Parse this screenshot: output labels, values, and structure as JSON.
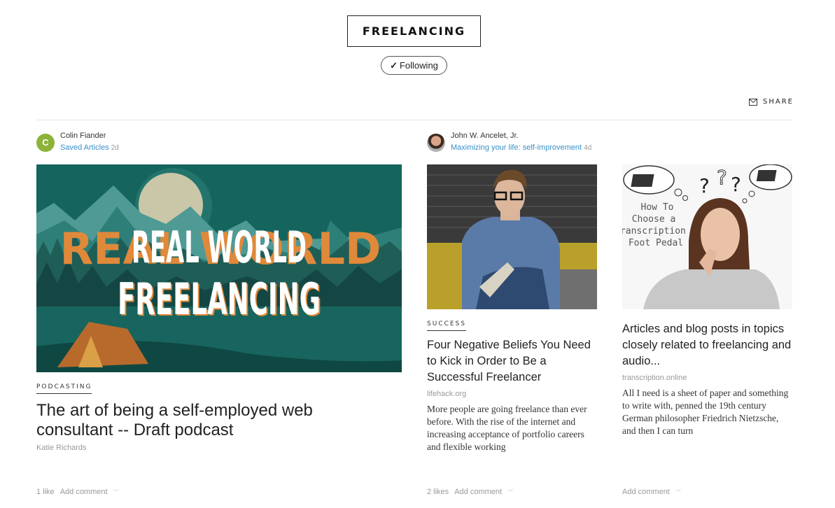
{
  "topic": {
    "title": "FREELANCING",
    "follow_label": "Following",
    "follow_icon": "checkmark-icon"
  },
  "toolbar": {
    "share_label": "SHARE",
    "share_icon": "envelope-icon"
  },
  "cards": [
    {
      "author": "Colin Fiander",
      "avatar_initial": "C",
      "avatar_color": "#8db33a",
      "source": "Saved Articles",
      "time": "2d",
      "image_text": [
        "REAL WORLD",
        "FREELANCING"
      ],
      "tag": "PODCASTING",
      "title": "The art of being a self-employed web consultant -- Draft podcast",
      "byline": "Katie Richards",
      "likes": "1 like",
      "comment_label": "Add comment"
    },
    {
      "author": "John W. Ancelet, Jr.",
      "source": "Maximizing your life: self-improvement",
      "time": "4d",
      "tag": "SUCCESS",
      "title": "Four Negative Beliefs You Need to Kick in Order to Be a Successful Freelancer",
      "domain": "lifehack.org",
      "excerpt": "More people are going freelance than ever before. With the rise of the internet and increasing acceptance of portfolio careers and flexible working",
      "likes": "2 likes",
      "comment_label": "Add comment"
    },
    {
      "image_text": [
        "How To",
        "Choose a",
        "Transcription",
        "Foot Pedal"
      ],
      "title": "Articles and blog posts in topics closely related to freelancing and audio...",
      "domain": "transcription.online",
      "excerpt": "All I need is a sheet of paper and something to write with, penned the 19th century German philosopher Friedrich Nietzsche, and then I can turn",
      "comment_label": "Add comment"
    }
  ],
  "colors": {
    "link": "#3a8fc7",
    "muted": "#999999",
    "teal_bg": "#14625c"
  }
}
